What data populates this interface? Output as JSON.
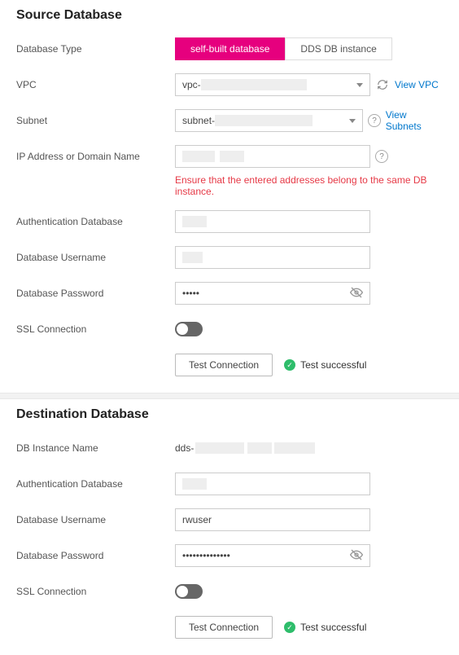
{
  "source": {
    "title": "Source Database",
    "dbType": {
      "label": "Database Type",
      "options": [
        "self-built database",
        "DDS DB instance"
      ],
      "selected": "self-built database"
    },
    "vpc": {
      "label": "VPC",
      "valuePrefix": "vpc-",
      "viewLink": "View VPC"
    },
    "subnet": {
      "label": "Subnet",
      "valuePrefix": "subnet-",
      "viewLink": "View Subnets"
    },
    "ipAddress": {
      "label": "IP Address or Domain Name",
      "warning": "Ensure that the entered addresses belong to the same DB instance."
    },
    "authDb": {
      "label": "Authentication Database"
    },
    "username": {
      "label": "Database Username"
    },
    "password": {
      "label": "Database Password",
      "value": "•••••"
    },
    "ssl": {
      "label": "SSL Connection"
    },
    "testButton": "Test Connection",
    "testStatus": "Test successful"
  },
  "destination": {
    "title": "Destination Database",
    "instanceName": {
      "label": "DB Instance Name",
      "valuePrefix": "dds-"
    },
    "authDb": {
      "label": "Authentication Database"
    },
    "username": {
      "label": "Database Username",
      "value": "rwuser"
    },
    "password": {
      "label": "Database Password",
      "value": "••••••••••••••"
    },
    "ssl": {
      "label": "SSL Connection"
    },
    "testButton": "Test Connection",
    "testStatus": "Test successful"
  }
}
